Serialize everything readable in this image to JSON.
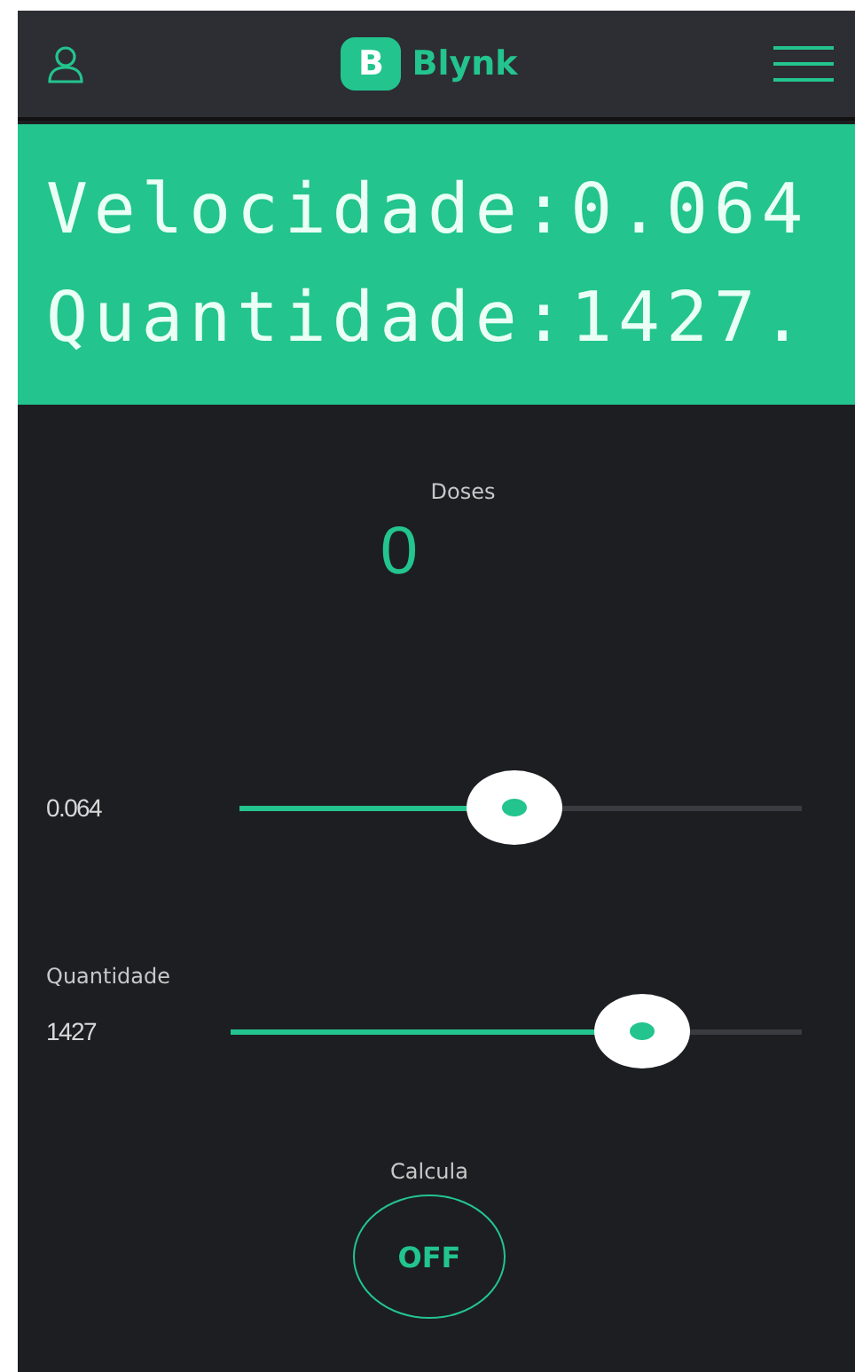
{
  "header": {
    "title": "Blynk",
    "logo_letter": "B"
  },
  "lcd": {
    "lines": [
      "Velocidade:0.064",
      "Quantidade:1427."
    ]
  },
  "value_display": {
    "label": "Doses",
    "value": "0"
  },
  "sliders": [
    {
      "value": "0.064",
      "level": 0.49
    },
    {
      "label": "Quantidade",
      "value": "1427",
      "level": 0.72
    }
  ],
  "button": {
    "label": "Calcula",
    "text": "OFF",
    "on": false
  }
}
